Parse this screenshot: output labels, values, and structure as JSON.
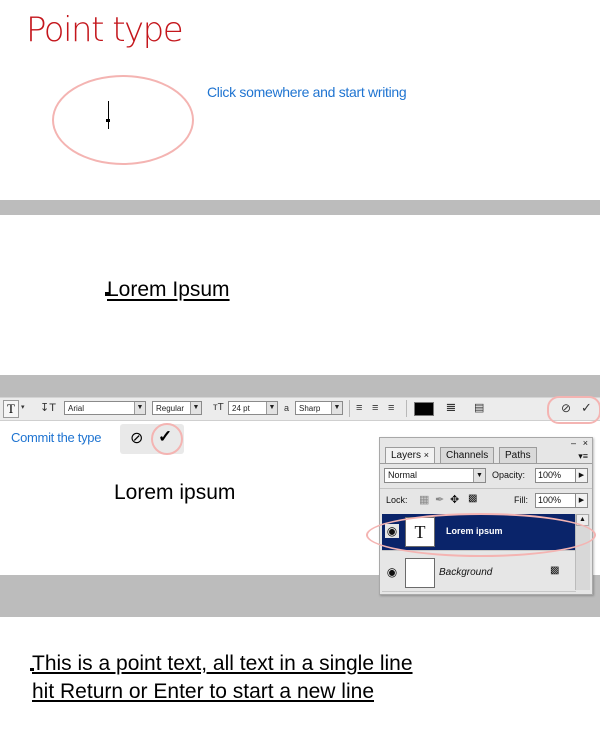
{
  "title": "Point type",
  "hint": "Click somewhere and start writing",
  "sample1": "Lorem Ipsum",
  "toolbar": {
    "tool_letter": "T",
    "font_family": "Arial",
    "font_style": "Regular",
    "font_size": "24 pt",
    "aa_label": "a",
    "antialias": "Sharp"
  },
  "commit_label": "Commit the type",
  "sample2": "Lorem ipsum",
  "layers_panel": {
    "tabs": [
      "Layers",
      "Channels",
      "Paths"
    ],
    "blend_mode": "Normal",
    "opacity_label": "Opacity:",
    "opacity_value": "100%",
    "lock_label": "Lock:",
    "fill_label": "Fill:",
    "fill_value": "100%",
    "layers": [
      {
        "name": "Lorem ipsum",
        "type": "text",
        "thumb": "T",
        "selected": true
      },
      {
        "name": "Background",
        "type": "background",
        "selected": false
      }
    ]
  },
  "body_lines": [
    "This is a point text, all text in a single line",
    "hit Return or Enter to start a new line"
  ],
  "colors": {
    "title": "#c4161c",
    "note": "#1f74d1",
    "highlight": "#f4b4b2",
    "selected_layer": "#0a246a",
    "separator": "#bcbcbc"
  }
}
